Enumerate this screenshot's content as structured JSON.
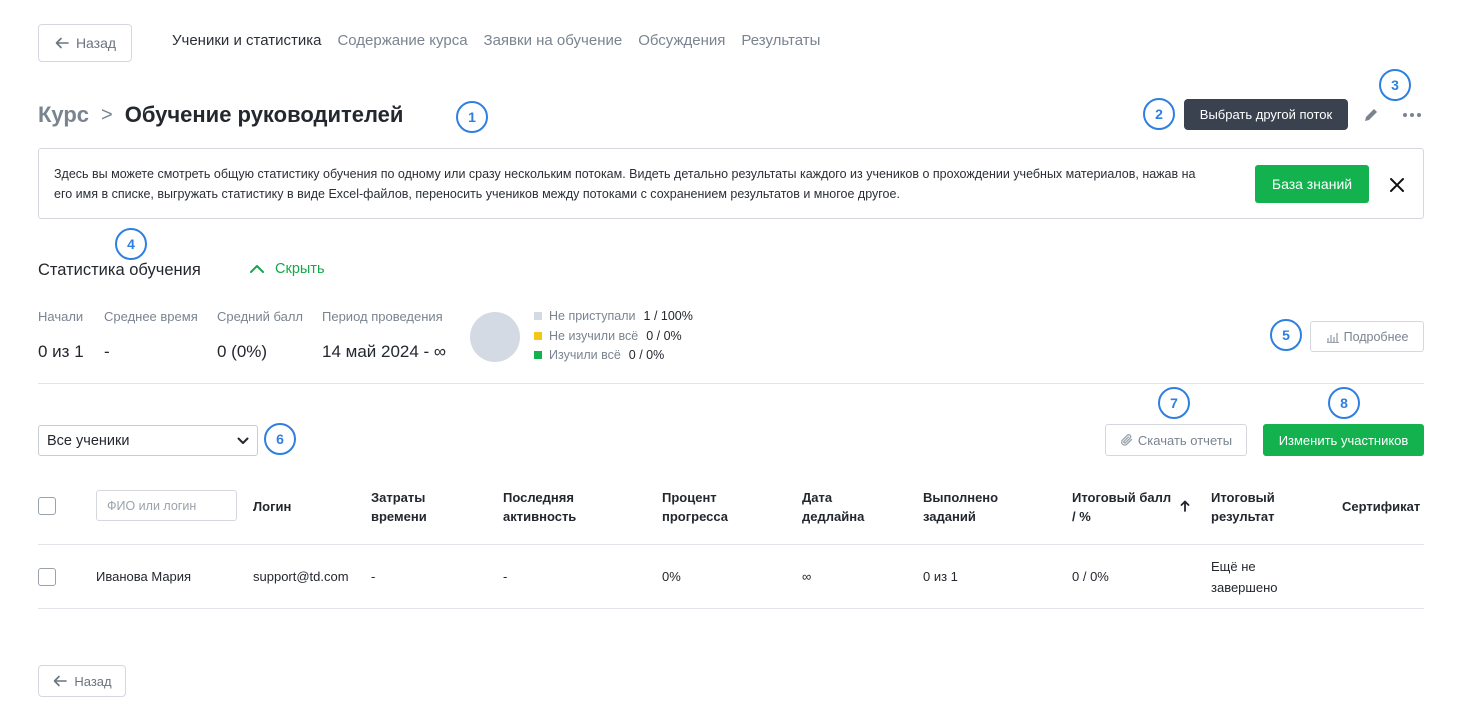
{
  "nav": {
    "back_label": "Назад",
    "tabs": [
      {
        "label": "Ученики и статистика",
        "active": true
      },
      {
        "label": "Содержание курса",
        "active": false
      },
      {
        "label": "Заявки на обучение",
        "active": false
      },
      {
        "label": "Обсуждения",
        "active": false
      },
      {
        "label": "Результаты",
        "active": false
      }
    ]
  },
  "header": {
    "course_label": "Курс",
    "separator": ">",
    "title": "Обучение руководителей",
    "stream_button": "Выбрать другой поток",
    "edit_icon": "pencil-icon",
    "more_icon": "more-horizontal-icon"
  },
  "markers": [
    "1",
    "2",
    "3",
    "4",
    "5",
    "6",
    "7",
    "8"
  ],
  "info": {
    "text": "Здесь вы можете смотреть общую статистику обучения по одному или сразу нескольким потокам. Видеть детально результаты каждого из учеников о прохождении учебных материалов, нажав на его имя в списке, выгружать статистику в виде Excel-файлов, переносить учеников между потоками с сохранением результатов и многое другое.",
    "kb_button": "База знаний",
    "close_icon": "close-icon"
  },
  "stats": {
    "title": "Статистика обучения",
    "hide_label": "Скрыть",
    "items": [
      {
        "label": "Начали",
        "value": "0 из 1"
      },
      {
        "label": "Среднее время",
        "value": "-"
      },
      {
        "label": "Средний балл",
        "value": "0 (0%)"
      },
      {
        "label": "Период проведения",
        "value": "14 май 2024 - ∞"
      }
    ],
    "legend": [
      {
        "label": "Не приступали",
        "value": "1 / 100%",
        "color": "#d4dae4"
      },
      {
        "label": "Не изучили всё",
        "value": "0 / 0%",
        "color": "#f5c518"
      },
      {
        "label": "Изучили всё",
        "value": "0 / 0%",
        "color": "#13b24f"
      }
    ],
    "details_button": "Подробнее"
  },
  "toolbar": {
    "filter_value": "Все ученики",
    "download_button": "Скачать отчеты",
    "change_button": "Изменить участников"
  },
  "table": {
    "search_placeholder": "ФИО или логин",
    "headers": {
      "login": "Логин",
      "time_1": "Затраты",
      "time_2": "времени",
      "activity_1": "Последняя",
      "activity_2": "активность",
      "progress_1": "Процент",
      "progress_2": "прогресса",
      "deadline_1": "Дата",
      "deadline_2": "дедлайна",
      "tasks_1": "Выполнено",
      "tasks_2": "заданий",
      "score_1": "Итоговый балл",
      "score_2": "/ %",
      "result_1": "Итоговый",
      "result_2": "результат",
      "certificate": "Сертификат"
    },
    "rows": [
      {
        "name": "Иванова Мария",
        "login": "support@td.com",
        "time": "-",
        "activity": "-",
        "progress": "0%",
        "deadline": "∞",
        "tasks": "0 из 1",
        "score": "0 / 0%",
        "result_1": "Ещё не",
        "result_2": "завершено"
      }
    ]
  },
  "footer": {
    "back_label": "Назад"
  },
  "colors": {
    "accent_green": "#13b24f",
    "marker_blue": "#2f7fe0",
    "dark_button": "#3a4250"
  }
}
